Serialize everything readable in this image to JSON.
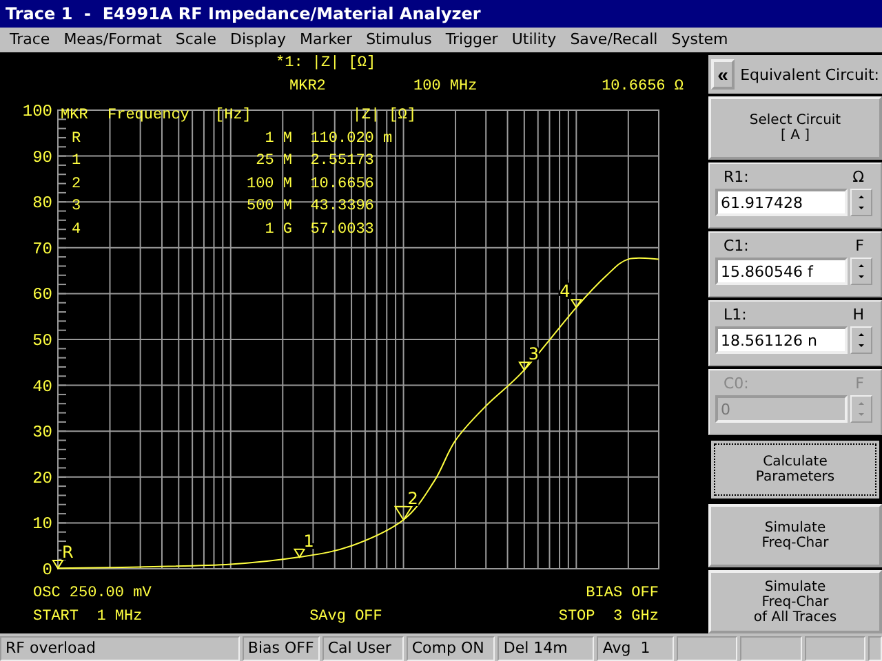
{
  "window": {
    "title": "Trace 1  -  E4991A RF Impedance/Material Analyzer"
  },
  "menu": [
    "Trace",
    "Meas/Format",
    "Scale",
    "Display",
    "Marker",
    "Stimulus",
    "Trigger",
    "Utility",
    "Save/Recall",
    "System"
  ],
  "display": {
    "trace_title": "*1: |Z| [Ω]",
    "active_marker": {
      "name": "MKR2",
      "frequency": "100 MHz",
      "value": "10.6656 Ω"
    },
    "marker_table": {
      "columns": [
        "MKR",
        "Frequency",
        "[Hz]",
        "|Z| [Ω]"
      ],
      "rows": [
        [
          "R",
          "1 M",
          "110.020 m"
        ],
        [
          "1",
          "25 M",
          "2.55173"
        ],
        [
          "2",
          "100 M",
          "10.6656"
        ],
        [
          "3",
          "500 M",
          "43.3396"
        ],
        [
          "4",
          "1 G",
          "57.0033"
        ]
      ]
    },
    "y_axis_labels": [
      "100",
      "90",
      "80",
      "70",
      "60",
      "50",
      "40",
      "30",
      "20",
      "10",
      "0"
    ],
    "trace_markers": [
      {
        "label": "R",
        "selected": false
      },
      {
        "label": "1",
        "selected": false
      },
      {
        "label": "2",
        "selected": true
      },
      {
        "label": "3",
        "selected": false
      },
      {
        "label": "4",
        "selected": false
      }
    ],
    "osc": "OSC 250.00 mV",
    "bias": "BIAS OFF",
    "start": "START  1 MHz",
    "savg": "SAvg OFF",
    "stop": "STOP  3 GHz"
  },
  "panel": {
    "collapse_button": "«",
    "title": "Equivalent Circuit:",
    "items": [
      {
        "kind": "button",
        "label": "Select Circuit\n[ A ]",
        "focused": false
      },
      {
        "kind": "param",
        "name": "R1:",
        "unit": "Ω",
        "value": "61.917428",
        "disabled": false
      },
      {
        "kind": "param",
        "name": "C1:",
        "unit": "F",
        "value": "15.860546 f",
        "disabled": false
      },
      {
        "kind": "param",
        "name": "L1:",
        "unit": "H",
        "value": "18.561126 n",
        "disabled": false
      },
      {
        "kind": "param",
        "name": "C0:",
        "unit": "F",
        "value": "0",
        "disabled": true
      },
      {
        "kind": "button",
        "label": "Calculate\nParameters",
        "focused": true
      },
      {
        "kind": "button",
        "label": "Simulate\nFreq-Char",
        "focused": false
      },
      {
        "kind": "button",
        "label": "Simulate\nFreq-Char\nof All Traces",
        "focused": false
      }
    ]
  },
  "status_bar": [
    "RF overload",
    "Bias OFF",
    "Cal User",
    "Comp ON",
    "Del 14m",
    "Avg  1"
  ]
}
